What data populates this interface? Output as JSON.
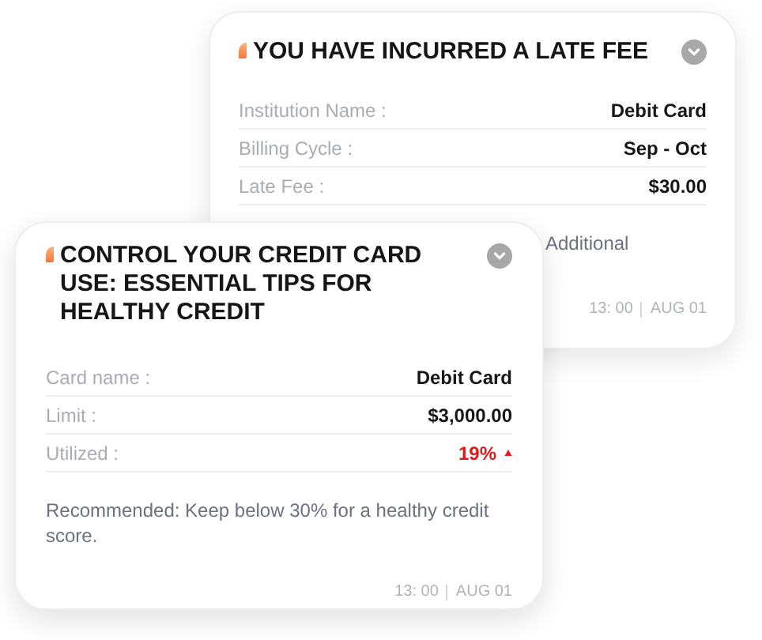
{
  "cards": [
    {
      "title": "YOU HAVE INCURRED A LATE FEE",
      "rows": [
        {
          "label": "Institution Name :",
          "value": "Debit Card",
          "alert": false
        },
        {
          "label": "Billing Cycle :",
          "value": "Sep - Oct",
          "alert": false
        },
        {
          "label": "Late Fee :",
          "value": "$30.00",
          "alert": false
        }
      ],
      "message": "Additional",
      "time": "13: 00",
      "date": "AUG 01"
    },
    {
      "title": "CONTROL YOUR CREDIT CARD USE: ESSENTIAL TIPS FOR HEALTHY CREDIT",
      "rows": [
        {
          "label": "Card name :",
          "value": "Debit Card",
          "alert": false
        },
        {
          "label": "Limit :",
          "value": "$3,000.00",
          "alert": false
        },
        {
          "label": "Utilized :",
          "value": "19%",
          "alert": true
        }
      ],
      "message": "Recommended: Keep below 30% for a healthy credit score.",
      "time": "13: 00",
      "date": "AUG 01"
    }
  ]
}
